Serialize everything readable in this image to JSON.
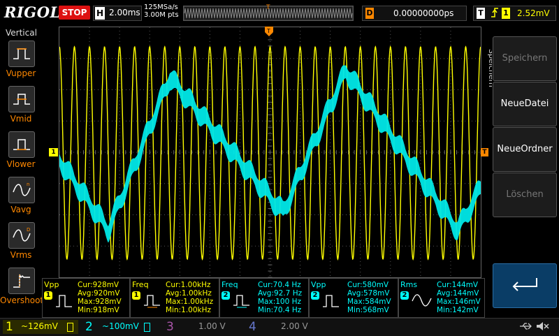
{
  "header": {
    "brand": "RIGOL",
    "run_state": "STOP",
    "horizontal_key": "H",
    "timebase": "2.00ms",
    "sample_rate": "125MSa/s",
    "memory_depth": "3.00M pts",
    "trigger_marker": "T",
    "delay_key": "D",
    "delay_value": "0.00000000ps",
    "trigger_key": "T",
    "trigger_edge_icon": "rising-edge-icon",
    "trigger_source": "1",
    "trigger_level": "2.52mV"
  },
  "sidebar": {
    "title": "Vertical",
    "items": [
      {
        "label": "Vupper",
        "icon": "vupper-icon"
      },
      {
        "label": "Vmid",
        "icon": "vmid-icon"
      },
      {
        "label": "Vlower",
        "icon": "vlower-icon"
      },
      {
        "label": "Vavg",
        "icon": "vavg-icon"
      },
      {
        "label": "Vrms",
        "icon": "vrms-icon"
      },
      {
        "label": "Overshoot",
        "icon": "overshoot-icon"
      }
    ]
  },
  "menu": {
    "title": "Speichern",
    "buttons": [
      {
        "label": "Speichern",
        "enabled": false
      },
      {
        "label": "NeueDatei",
        "enabled": true
      },
      {
        "label": "NeueOrdner",
        "enabled": true
      },
      {
        "label": "Löschen",
        "enabled": false
      }
    ],
    "enter_icon": "return-arrow-icon"
  },
  "markers": {
    "ch1_ground": "1",
    "trigger_level_marker": "T"
  },
  "measurements": [
    {
      "name": "Vpp",
      "channel": "1",
      "color": "#ffff00",
      "cur": "Cur:928mV",
      "avg": "Avg:920mV",
      "max": "Max:928mV",
      "min": "Min:918mV"
    },
    {
      "name": "Freq",
      "channel": "1",
      "color": "#ffff00",
      "cur": "Cur:1.00kHz",
      "avg": "Avg:1.00kHz",
      "max": "Max:1.00kHz",
      "min": "Min:1.00kHz"
    },
    {
      "name": "Freq",
      "channel": "2",
      "color": "#00ffff",
      "cur": "Cur:70.4 Hz",
      "avg": "Avg:92.7 Hz",
      "max": "Max:100 Hz",
      "min": "Min:70.4 Hz"
    },
    {
      "name": "Vpp",
      "channel": "2",
      "color": "#00ffff",
      "cur": "Cur:580mV",
      "avg": "Avg:578mV",
      "max": "Max:584mV",
      "min": "Min:568mV"
    },
    {
      "name": "Rms",
      "channel": "2",
      "color": "#00ffff",
      "cur": "Cur:144mV",
      "avg": "Avg:144mV",
      "max": "Max:146mV",
      "min": "Min:142mV"
    }
  ],
  "channels": [
    {
      "num": "1",
      "scale": "~126mV",
      "color": "#ffff00"
    },
    {
      "num": "2",
      "scale": "~100mV",
      "color": "#00ffff"
    },
    {
      "num": "3",
      "scale": "1.00 V",
      "color": "#cc66cc"
    },
    {
      "num": "4",
      "scale": "2.00 V",
      "color": "#6699ff"
    }
  ],
  "status_icons": [
    "usb-icon",
    "mute-icon"
  ],
  "colors": {
    "ch1": "#ffff00",
    "ch2": "#00ffff",
    "accent": "#ff8800",
    "stop": "#dd1111"
  }
}
